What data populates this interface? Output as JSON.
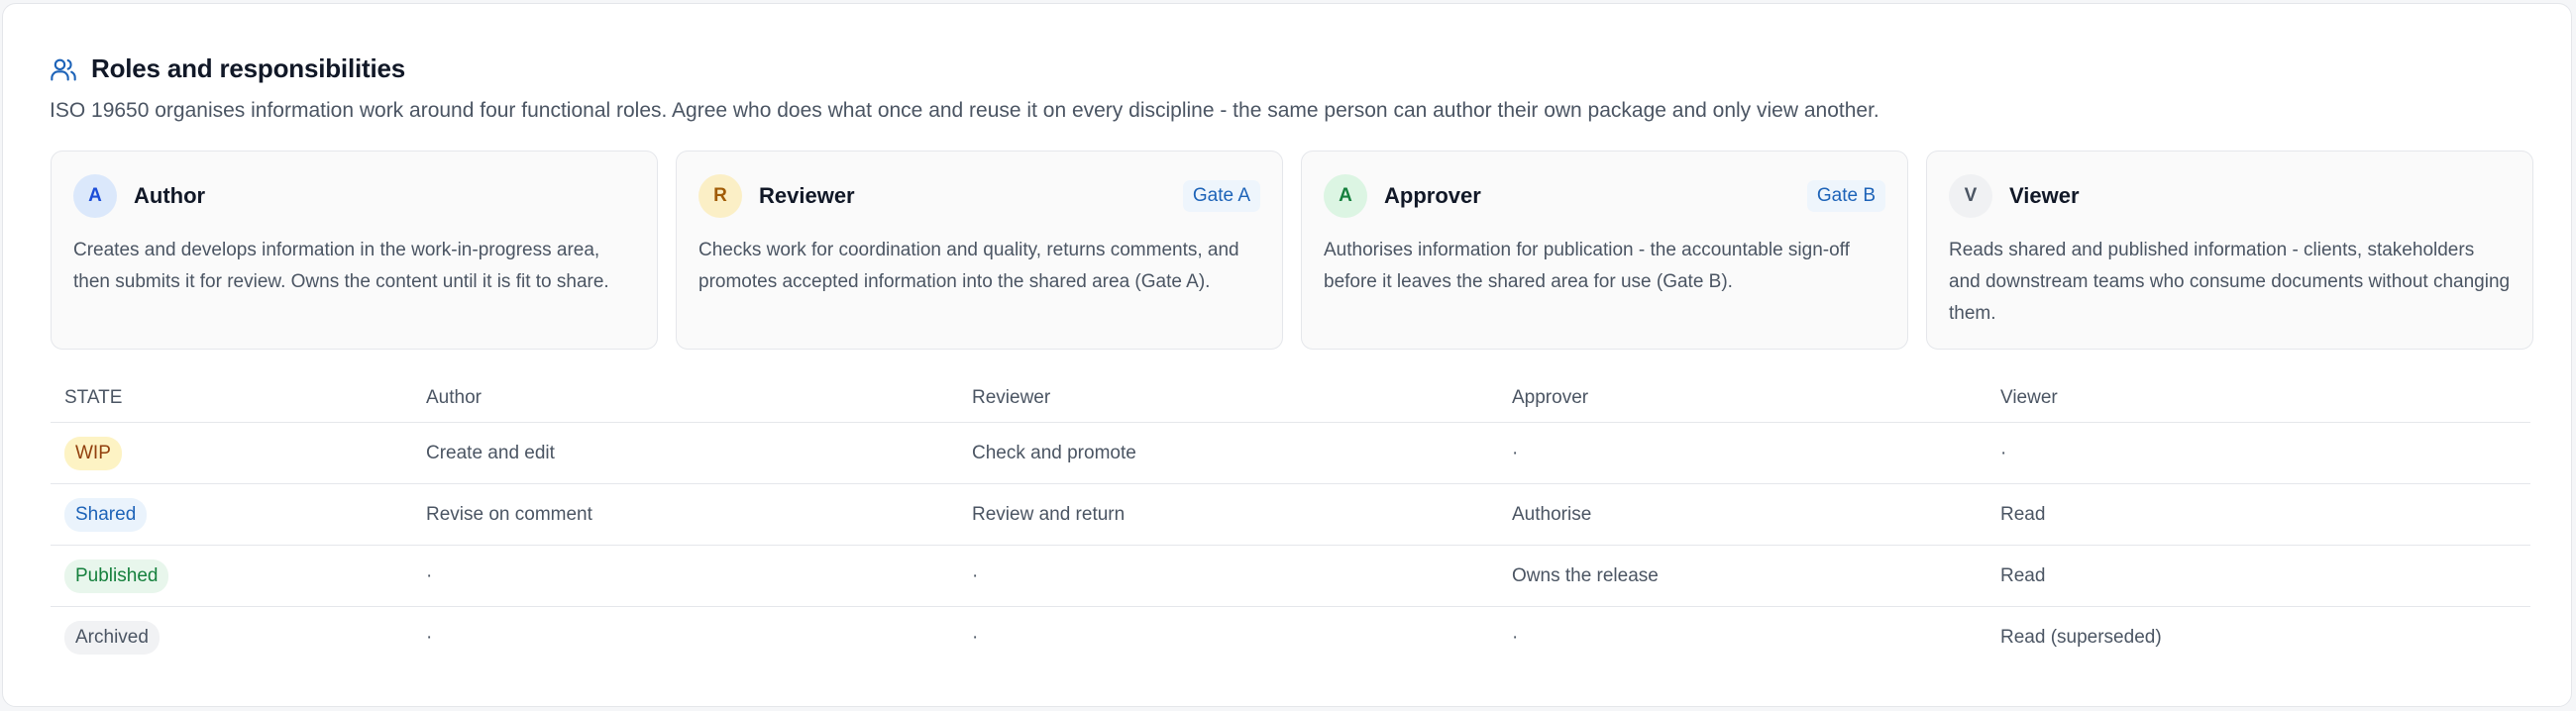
{
  "section": {
    "title": "Roles and responsibilities",
    "icon": "users-icon",
    "description": "ISO 19650 organises information work around four functional roles. Agree who does what once and reuse it on every discipline - the same person can author their own package and only view another."
  },
  "roles": [
    {
      "initial": "A",
      "name": "Author",
      "gate": "",
      "description": "Creates and develops information in the work-in-progress area, then submits it for review. Owns the content until it is fit to share.",
      "avatar_bg": "#dbe8fb",
      "avatar_fg": "#1d4ed8"
    },
    {
      "initial": "R",
      "name": "Reviewer",
      "gate": "Gate A",
      "description": "Checks work for coordination and quality, returns comments, and promotes accepted information into the shared area (Gate A).",
      "avatar_bg": "#fbefc6",
      "avatar_fg": "#a15c07"
    },
    {
      "initial": "A",
      "name": "Approver",
      "gate": "Gate B",
      "description": "Authorises information for publication - the accountable sign-off before it leaves the shared area for use (Gate B).",
      "avatar_bg": "#dcf5e3",
      "avatar_fg": "#15803d"
    },
    {
      "initial": "V",
      "name": "Viewer",
      "gate": "",
      "description": "Reads shared and published information - clients, stakeholders and downstream teams who consume documents without changing them.",
      "avatar_bg": "#f0f1f3",
      "avatar_fg": "#4b5563"
    }
  ],
  "matrix": {
    "headers": [
      "STATE",
      "Author",
      "Reviewer",
      "Approver",
      "Viewer"
    ],
    "rows": [
      {
        "state": "WIP",
        "pill_bg": "#fdf3c4",
        "pill_fg": "#92400e",
        "cells": [
          "Create and edit",
          "Check and promote",
          "·",
          "·"
        ]
      },
      {
        "state": "Shared",
        "pill_bg": "#eaf3fc",
        "pill_fg": "#1d63b8",
        "cells": [
          "Revise on comment",
          "Review and return",
          "Authorise",
          "Read"
        ]
      },
      {
        "state": "Published",
        "pill_bg": "#e8f6ec",
        "pill_fg": "#15803d",
        "cells": [
          "·",
          "·",
          "Owns the release",
          "Read"
        ]
      },
      {
        "state": "Archived",
        "pill_bg": "#f1f2f4",
        "pill_fg": "#4b5563",
        "cells": [
          "·",
          "·",
          "·",
          "Read (superseded)"
        ]
      }
    ]
  }
}
